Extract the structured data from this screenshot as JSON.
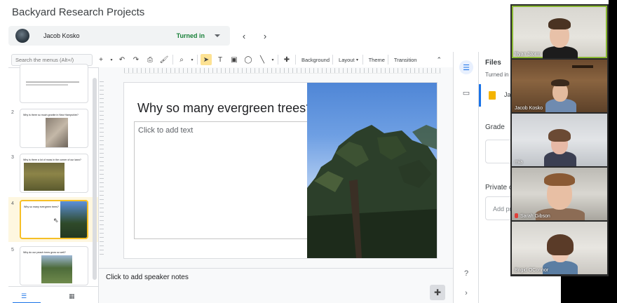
{
  "header": {
    "title": "Backyard Research Projects",
    "student_name": "Jacob Kosko",
    "status": "Turned in"
  },
  "toolbar": {
    "search_placeholder": "Search the menus (Alt+/)",
    "background": "Background",
    "layout": "Layout",
    "theme": "Theme",
    "transition": "Transition"
  },
  "filmstrip": {
    "slides": [
      {
        "number": "",
        "title": ""
      },
      {
        "number": "2",
        "title": "Why is there so much granite in New Hampshire?"
      },
      {
        "number": "3",
        "title": "Why is there a lot of moss in the corner of our lawn?"
      },
      {
        "number": "4",
        "title": "Why so many evergreen trees?"
      },
      {
        "number": "5",
        "title": "Why do our peach trees grow so well?"
      }
    ]
  },
  "slide": {
    "title": "Why so many evergreen trees?",
    "body_placeholder": "Click to add text"
  },
  "notes": {
    "placeholder": "Click to add speaker notes"
  },
  "files_panel": {
    "title": "Files",
    "status": "Turned in o",
    "file_name": "Ja",
    "grade_label": "Grade",
    "private_label": "Private c",
    "comment_placeholder": "Add pr"
  },
  "participants": [
    {
      "name": "Ryan Storm",
      "muted": false,
      "speaking": true
    },
    {
      "name": "Jacob Kosko",
      "muted": false,
      "speaking": false
    },
    {
      "name": "mia",
      "muted": false,
      "speaking": false
    },
    {
      "name": "Sarah Gibson",
      "muted": true,
      "speaking": false
    },
    {
      "name": "Brigid OConnor",
      "muted": false,
      "speaking": false
    }
  ],
  "colors": {
    "accent": "#1a73e8",
    "turned_in": "#188038",
    "selected_slide": "#f6bf26",
    "speaking_border": "#8ab833"
  }
}
